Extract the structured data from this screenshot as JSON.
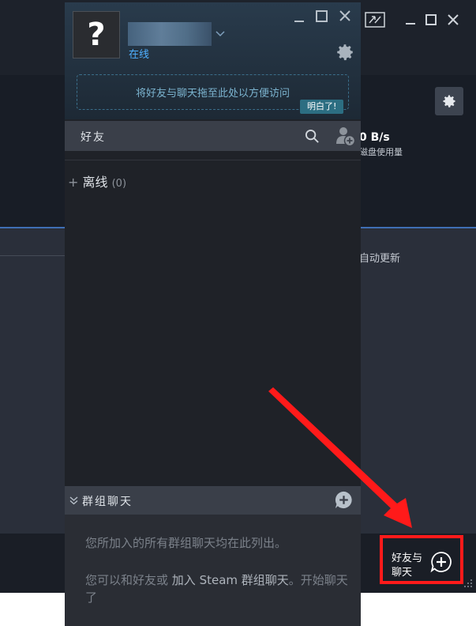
{
  "panel": {
    "status": "在线",
    "avatar_glyph": "?",
    "drop_hint": "将好友与聊天拖至此处以方便访问",
    "got_it": "明白了!",
    "friends_label": "好友",
    "offline_label": "离线",
    "offline_count": "(0)",
    "group_label": "群组聊天",
    "group_line1": "您所加入的所有群组聊天均在此列出。",
    "group_line2_pre": "您可以和好友或",
    "group_line2_link": "加入 Steam 群组聊天",
    "group_line2_post": "。开始聊天了"
  },
  "background": {
    "rate": "0 B/s",
    "disk": "磁盘使用量",
    "auto_update": "自动更新"
  },
  "chat_button": {
    "line1": "好友与",
    "line2": "聊天"
  },
  "colors": {
    "highlight": "#ff1a1a",
    "status": "#4fb0ff",
    "accent": "#3f6fb5"
  },
  "icons": {
    "minimize": "minimize-icon",
    "maximize": "maximize-icon",
    "close": "close-icon",
    "settings": "gear-icon",
    "search": "search-icon",
    "add_friend": "add-friend-icon",
    "add_group": "add-group-chat-icon",
    "new_chat": "new-chat-icon"
  }
}
